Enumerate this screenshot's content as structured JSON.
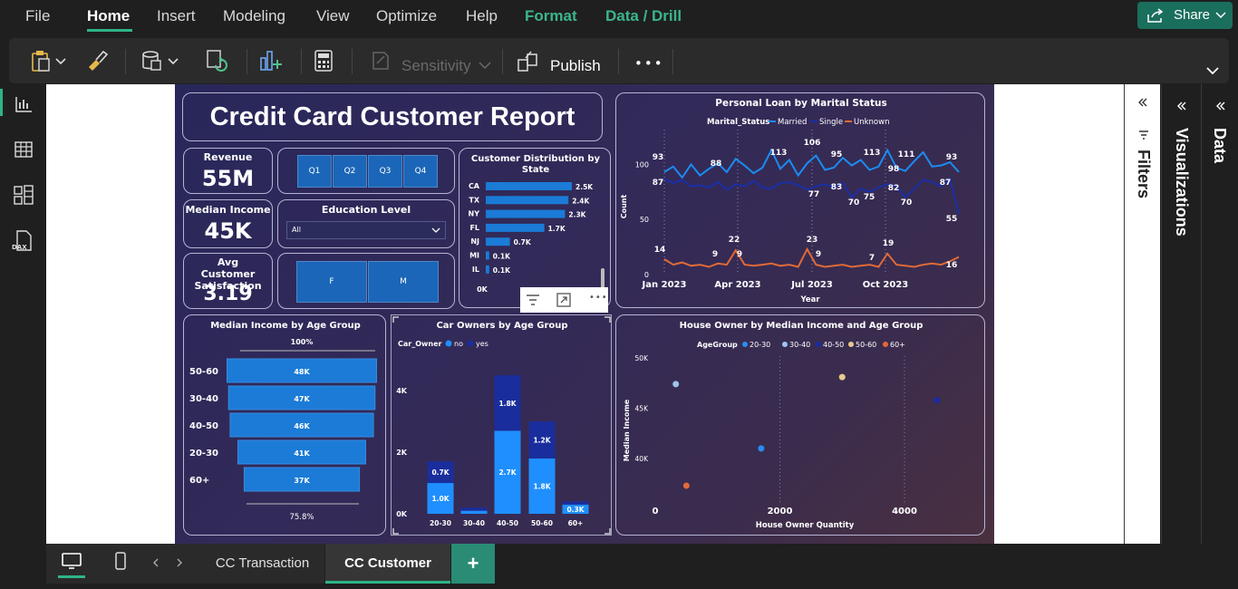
{
  "menu": {
    "items": [
      "File",
      "Home",
      "Insert",
      "Modeling",
      "View",
      "Optimize",
      "Help",
      "Format",
      "Data / Drill"
    ],
    "share_label": "Share"
  },
  "ribbon": {
    "sensitivity_label": "Sensitivity",
    "publish_label": "Publish",
    "more_label": "•••"
  },
  "colors": {
    "accent": "#2fb489",
    "married": "#1b8cf2",
    "single": "#1a2fa8",
    "unknown": "#e06a36",
    "bar": "#1b7bd6",
    "car_no": "#1f8fff",
    "car_yes": "#1a2d9c"
  },
  "report": {
    "title": "Credit Card Customer Report",
    "kpis": {
      "revenue_label": "Revenue",
      "revenue_value": "55M",
      "income_label": "Median Income",
      "income_value": "45K",
      "sat_label": "Avg Customer Satisfaction",
      "sat_value": "3.19"
    },
    "quarters": [
      "Q1",
      "Q2",
      "Q3",
      "Q4"
    ],
    "education": {
      "label": "Education Level",
      "value": "All"
    },
    "gender": [
      "F",
      "M"
    ]
  },
  "chart_data": [
    {
      "type": "bar",
      "title": "Customer Distribution by State",
      "categories": [
        "CA",
        "TX",
        "NY",
        "FL",
        "NJ",
        "MI",
        "IL"
      ],
      "values": [
        2.5,
        2.4,
        2.3,
        1.7,
        0.7,
        0.1,
        0.1
      ],
      "value_labels": [
        "2.5K",
        "2.4K",
        "2.3K",
        "1.7K",
        "0.7K",
        "0.1K",
        "0.1K"
      ],
      "axis_label": "0K"
    },
    {
      "type": "line",
      "title": "Personal Loan by Marital Status",
      "legend_title": "Marital_Status",
      "legend": [
        "Married",
        "Single",
        "Unknown"
      ],
      "xlabel": "Year",
      "ylabel": "Count",
      "x_ticks": [
        "Jan 2023",
        "Apr 2023",
        "Jul 2023",
        "Oct 2023"
      ],
      "y_ticks": [
        "0",
        "50",
        "100"
      ],
      "ylim": [
        0,
        125
      ],
      "series": [
        {
          "name": "Married",
          "values": [
            93,
            98,
            88,
            100,
            90,
            96,
            101,
            93,
            105,
            99,
            92,
            97,
            113,
            96,
            104,
            90,
            101,
            108,
            95,
            97,
            106,
            99,
            104,
            95,
            98,
            113,
            97,
            94,
            103,
            111,
            98,
            99,
            102,
            93
          ]
        },
        {
          "name": "Single",
          "values": [
            87,
            83,
            86,
            80,
            81,
            79,
            84,
            77,
            82,
            80,
            85,
            79,
            78,
            83,
            84,
            81,
            77,
            80,
            82,
            79,
            83,
            70,
            78,
            75,
            79,
            82,
            80,
            70,
            78,
            86,
            84,
            80,
            87,
            55
          ]
        },
        {
          "name": "Unknown",
          "values": [
            14,
            9,
            11,
            8,
            9,
            7,
            10,
            9,
            22,
            9,
            8,
            9,
            10,
            8,
            9,
            7,
            23,
            9,
            7,
            8,
            9,
            7,
            8,
            9,
            7,
            19,
            9,
            8,
            7,
            9,
            10,
            9,
            12,
            16
          ]
        }
      ],
      "point_labels": [
        "93",
        "87",
        "88",
        "113",
        "106",
        "95",
        "77",
        "83",
        "70",
        "75",
        "113",
        "98",
        "82",
        "111",
        "70",
        "93",
        "87",
        "55",
        "14",
        "9",
        "22",
        "9",
        "23",
        "9",
        "7",
        "19",
        "16"
      ]
    },
    {
      "type": "bar",
      "title": "Median Income by Age Group",
      "categories": [
        "50-60",
        "30-40",
        "40-50",
        "20-30",
        "60+"
      ],
      "values": [
        48,
        47,
        46,
        41,
        37
      ],
      "value_labels": [
        "48K",
        "47K",
        "46K",
        "41K",
        "37K"
      ],
      "top_label": "100%",
      "bottom_label": "75.8%"
    },
    {
      "type": "bar",
      "title": "Car Owners by Age Group",
      "legend_title": "Car_Owner",
      "legend": [
        "no",
        "yes"
      ],
      "categories": [
        "20-30",
        "30-40",
        "40-50",
        "50-60",
        "60+"
      ],
      "series": [
        {
          "name": "no",
          "values": [
            1.0,
            0.1,
            2.7,
            1.8,
            0.3
          ]
        },
        {
          "name": "yes",
          "values": [
            0.7,
            0.1,
            1.8,
            1.2,
            0.1
          ]
        }
      ],
      "value_labels": {
        "no": [
          "1.0K",
          "",
          "2.7K",
          "1.8K",
          "0.3K"
        ],
        "yes": [
          "0.7K",
          "",
          "1.8K",
          "1.2K",
          ""
        ]
      },
      "y_ticks": [
        "0K",
        "2K",
        "4K"
      ],
      "ylim": [
        0,
        4.8
      ]
    },
    {
      "type": "scatter",
      "title": "House Owner by Median Income and Age Group",
      "legend_title": "AgeGroup",
      "legend": [
        "20-30",
        "30-40",
        "40-50",
        "50-60",
        "60+"
      ],
      "legend_colors": [
        "#2a8cf0",
        "#9fc3ee",
        "#1a2ba0",
        "#e8c98c",
        "#e2683a"
      ],
      "xlabel": "House Owner Quantity",
      "ylabel": "Median Income",
      "x_ticks": [
        "0",
        "2000",
        "4000"
      ],
      "y_ticks": [
        "40K",
        "45K",
        "50K"
      ],
      "points": [
        {
          "group": "20-30",
          "x": 1700,
          "y": 41000
        },
        {
          "group": "30-40",
          "x": 330,
          "y": 47400
        },
        {
          "group": "40-50",
          "x": 4520,
          "y": 45800
        },
        {
          "group": "50-60",
          "x": 3000,
          "y": 48100
        },
        {
          "group": "60+",
          "x": 500,
          "y": 37300
        }
      ]
    }
  ],
  "panes": {
    "filters": "Filters",
    "visualizations": "Visualizations",
    "data": "Data"
  },
  "tabs": [
    "CC Transaction",
    "CC Customer"
  ],
  "add_tab": "+"
}
